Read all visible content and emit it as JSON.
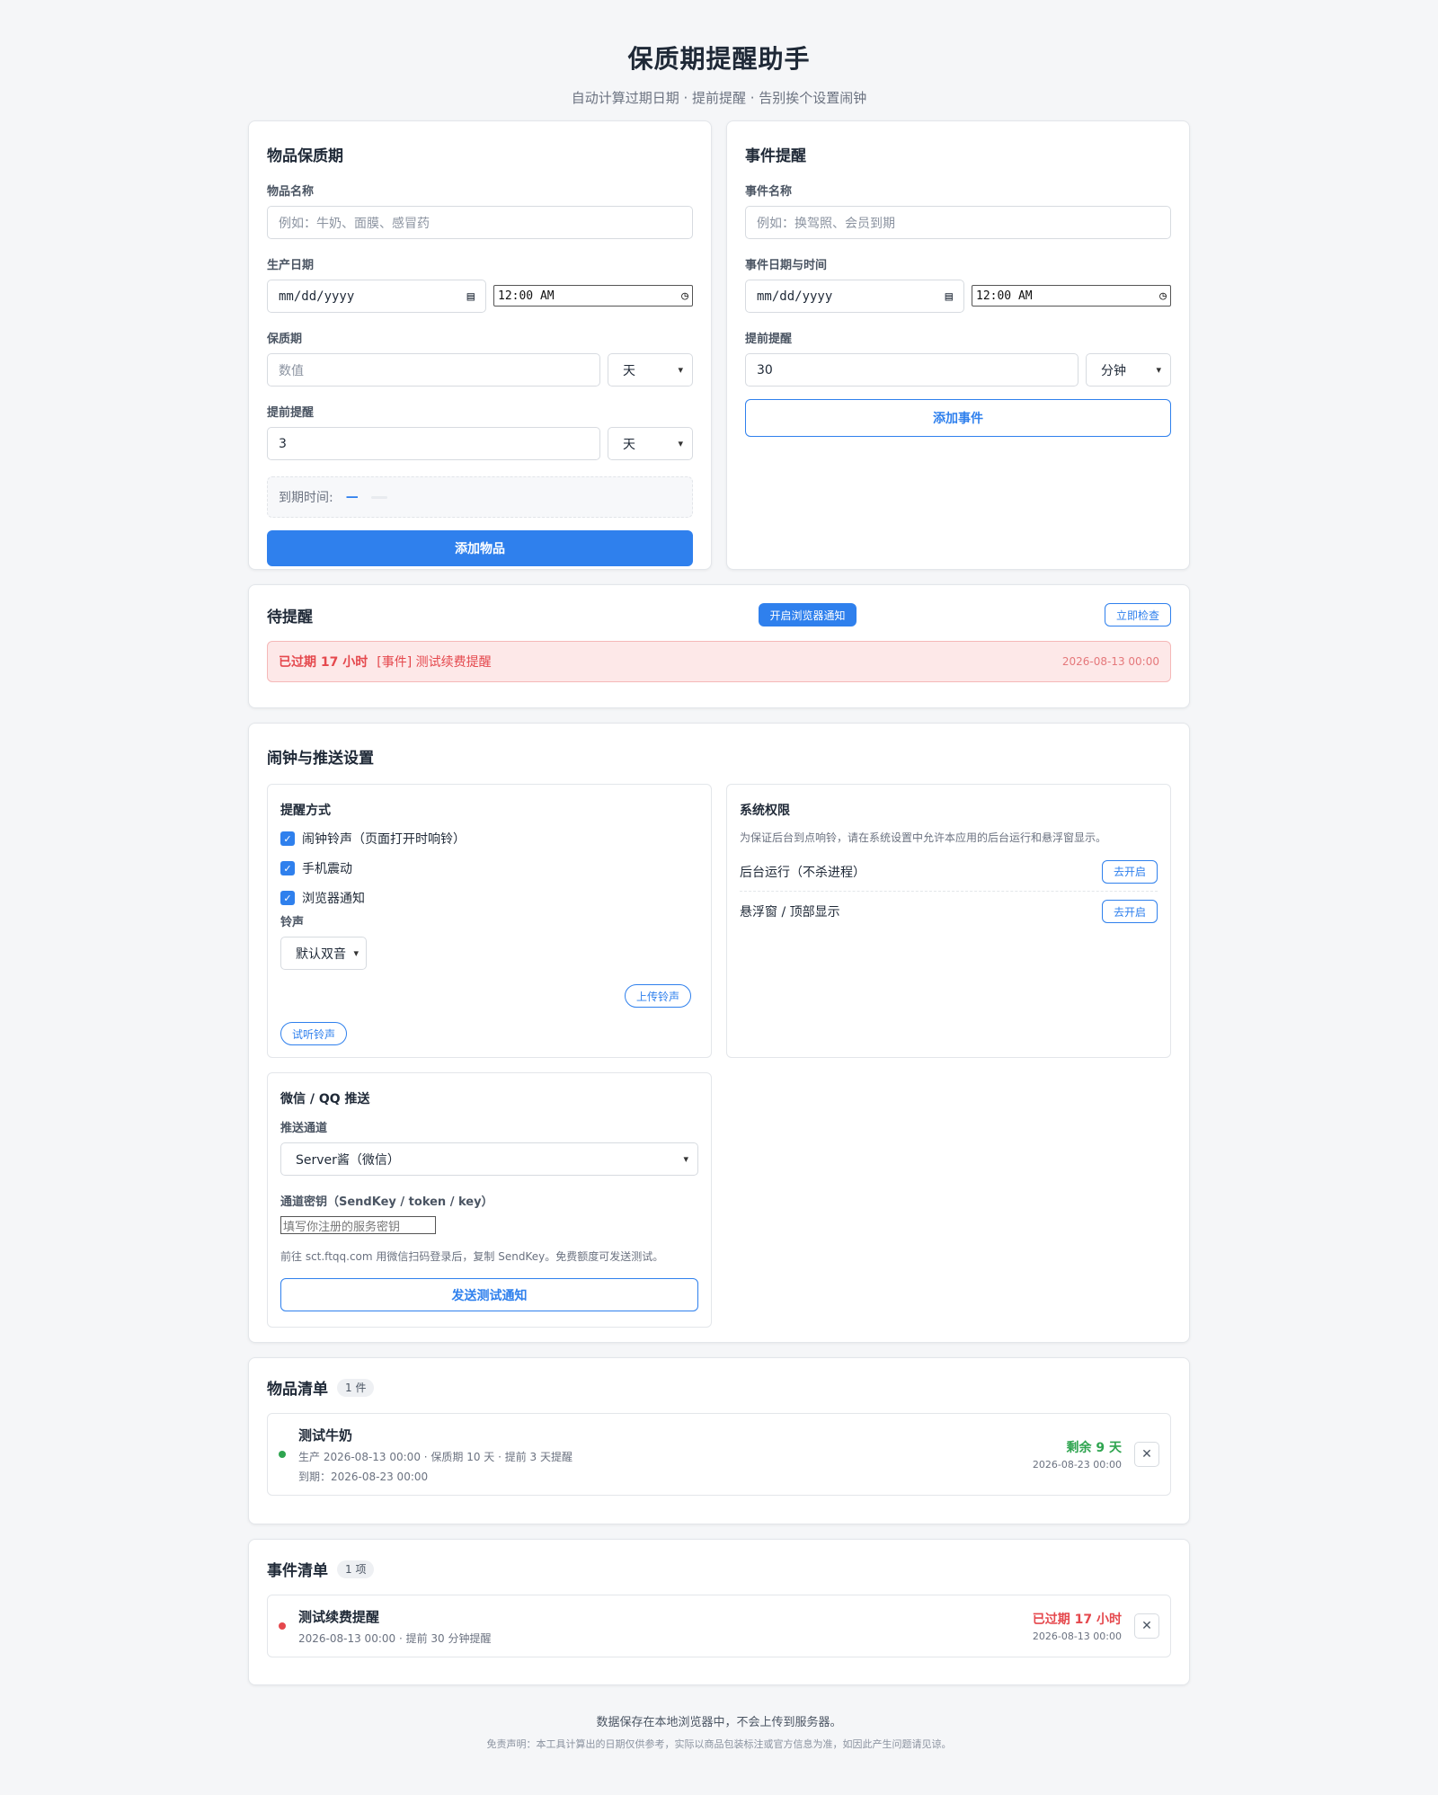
{
  "app": {
    "title": "保质期提醒助手",
    "subtitle": "自动计算过期日期 · 提前提醒 · 告别挨个设置闹钟"
  },
  "item_form": {
    "title": "物品保质期",
    "name_label": "物品名称",
    "name_placeholder": "例如：牛奶、面膜、感冒药",
    "production_label": "生产日期",
    "date_value": "mm/dd/yyyy",
    "time_value": "12:00 AM",
    "shelf_label": "保质期",
    "shelf_placeholder": "数值",
    "shelf_unit": "天",
    "advance_label": "提前提醒",
    "advance_value": "3",
    "advance_unit": "天",
    "expire_label": "到期时间:",
    "expire_value": "—",
    "submit": "添加物品"
  },
  "event_form": {
    "title": "事件提醒",
    "name_label": "事件名称",
    "name_placeholder": "例如：换驾照、会员到期",
    "datetime_label": "事件日期与时间",
    "date_value": "mm/dd/yyyy",
    "time_value": "12:00 AM",
    "advance_label": "提前提醒",
    "advance_value": "30",
    "advance_unit": "分钟",
    "submit": "添加事件"
  },
  "pending": {
    "title": "待提醒",
    "notify_button": "开启浏览器通知",
    "check_button": "立即检查",
    "alerts": [
      {
        "status": "已过期 17 小时",
        "text": "[事件] 测试续费提醒",
        "time": "2026-08-13 00:00"
      }
    ]
  },
  "settings": {
    "title": "闹钟与推送设置",
    "method": {
      "title": "提醒方式",
      "options": [
        "闹钟铃声（页面打开时响铃）",
        "手机震动",
        "浏览器通知"
      ],
      "ringtone_label": "铃声",
      "ringtone_value": "默认双音",
      "upload_button": "上传铃声",
      "preview_button": "试听铃声"
    },
    "permissions": {
      "title": "系统权限",
      "note": "为保证后台到点响铃，请在系统设置中允许本应用的后台运行和悬浮窗显示。",
      "items": [
        {
          "label": "后台运行（不杀进程）",
          "button": "去开启"
        },
        {
          "label": "悬浮窗 / 顶部显示",
          "button": "去开启"
        }
      ]
    },
    "push": {
      "title": "微信 / QQ 推送",
      "channel_label": "推送通道",
      "channel_value": "Server酱（微信）",
      "key_label": "通道密钥（SendKey / token / key）",
      "key_placeholder": "填写你注册的服务密钥",
      "hint": "前往 sct.ftqq.com 用微信扫码登录后，复制 SendKey。免费额度可发送测试。",
      "test_button": "发送测试通知"
    }
  },
  "items_list": {
    "title": "物品清单",
    "count": "1 件",
    "items": [
      {
        "name": "测试牛奶",
        "meta": "生产 2026-08-13 00:00 · 保质期 10 天 · 提前 3 天提醒",
        "expire": "到期：2026-08-23 00:00",
        "status": "剩余 9 天",
        "date": "2026-08-23 00:00",
        "dot_color": "#2ea44f"
      }
    ]
  },
  "events_list": {
    "title": "事件清单",
    "count": "1 项",
    "items": [
      {
        "name": "测试续费提醒",
        "meta": "2026-08-13 00:00 · 提前 30 分钟提醒",
        "status": "已过期 17 小时",
        "date": "2026-08-13 00:00",
        "dot_color": "#e5484d"
      }
    ]
  },
  "footer": {
    "line1": "数据保存在本地浏览器中，不会上传到服务器。",
    "line2": "免责声明：本工具计算出的日期仅供参考，实际以商品包装标注或官方信息为准，如因此产生问题请见谅。"
  },
  "colors": {
    "accent": "#2f80ed",
    "danger": "#e5484d",
    "success": "#2ea44f"
  }
}
